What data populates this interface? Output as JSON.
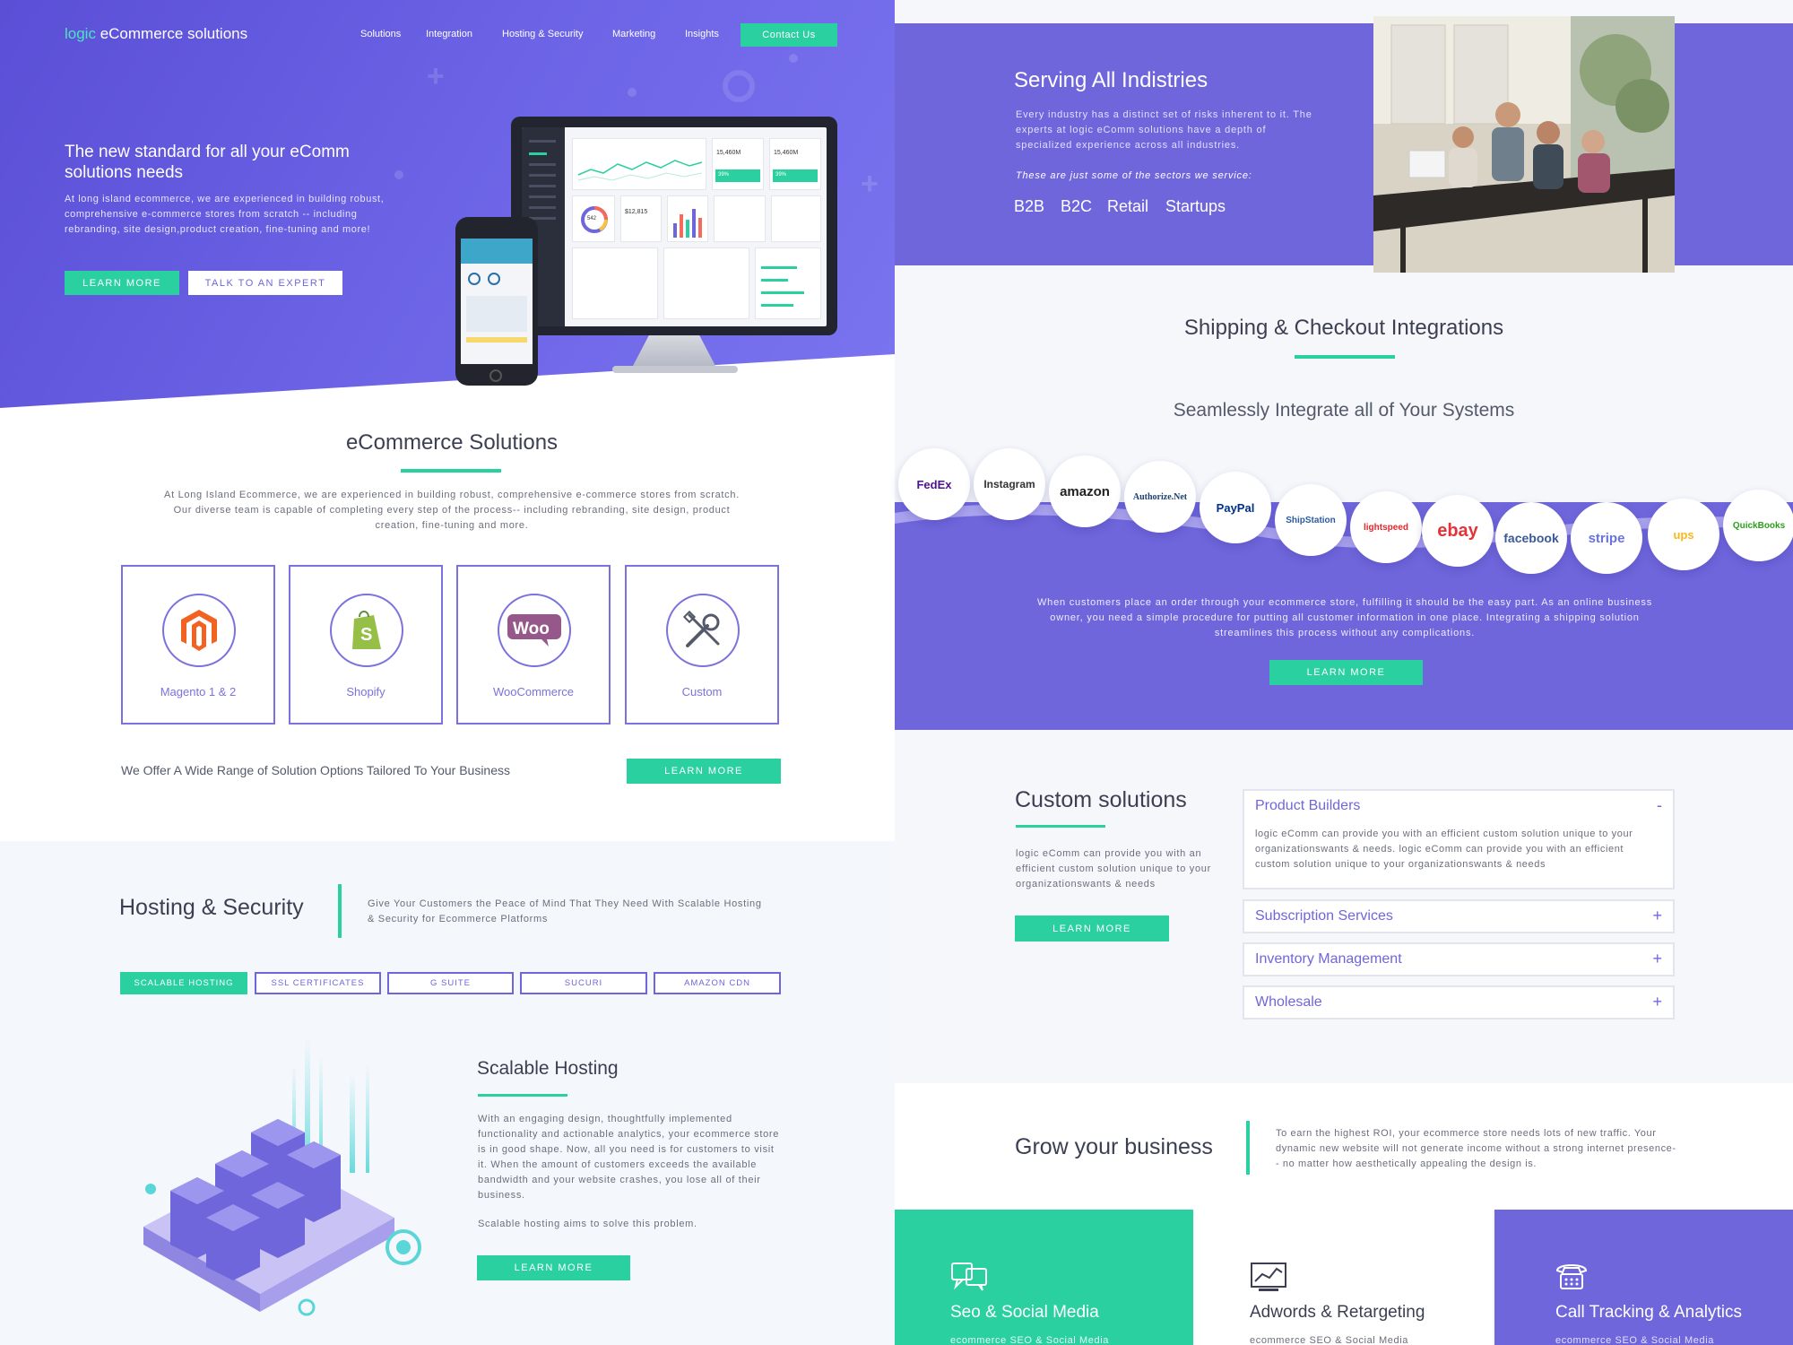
{
  "nav": {
    "logo_prefix": "logic",
    "logo_suffix": "eCommerce solutions",
    "items": [
      "Solutions",
      "Integration",
      "Hosting & Security",
      "Marketing",
      "Insights"
    ],
    "contact": "Contact Us"
  },
  "hero": {
    "title": "The new standard for all your eComm solutions needs",
    "text": "At long island ecommerce, we are experienced in building robust, comprehensive e-commerce stores from scratch -- including rebranding, site design,product creation, fine-tuning and more!",
    "learn_more": "LEARN MORE",
    "talk": "TALK TO AN EXPERT"
  },
  "dashboard": {
    "kpi1": "15,460M",
    "kpi2": "15,460M",
    "pct1": "39%",
    "pct2": "39%",
    "donut": "542",
    "bar_value": "$12,815"
  },
  "solutions": {
    "title": "eCommerce Solutions",
    "text": "At Long Island Ecommerce, we are experienced in building robust, comprehensive e-commerce stores from scratch. Our diverse team is capable of completing every step of the process-- including rebranding, site design, product creation, fine-tuning and more.",
    "items": [
      {
        "label": "Magento 1 & 2",
        "icon": "magento-icon"
      },
      {
        "label": "Shopify",
        "icon": "shopify-icon"
      },
      {
        "label": "WooCommerce",
        "icon": "woocommerce-icon"
      },
      {
        "label": "Custom",
        "icon": "tools-icon"
      }
    ],
    "offer_text": "We Offer A Wide Range of Solution Options Tailored To Your Business",
    "learn_more": "LEARN MORE"
  },
  "hosting": {
    "title": "Hosting & Security",
    "tagline": "Give Your Customers the Peace of Mind That They Need With Scalable Hosting & Security for Ecommerce Platforms",
    "tabs": [
      "SCALABLE HOSTING",
      "SSL CERTIFICATES",
      "G SUITE",
      "SUCURI",
      "AMAZON CDN"
    ],
    "sub_title": "Scalable Hosting",
    "body": "With an engaging design, thoughtfully implemented functionality and actionable analytics, your ecommerce store is in good shape. Now, all you need is for customers to visit it. When the amount of customers exceeds the available bandwidth and your website crashes, you lose all of their business.",
    "body2": "Scalable hosting aims to solve this problem.",
    "learn_more": "LEARN MORE"
  },
  "serving": {
    "title": "Serving All Indistries",
    "text": "Every industry has a distinct set of risks inherent to it. The experts at logic eComm solutions have a depth of specialized experience across all industries.",
    "italic": "These are just some of the sectors we service:",
    "sectors": [
      "B2B",
      "B2C",
      "Retail",
      "Startups"
    ]
  },
  "integrations": {
    "title": "Shipping & Checkout Integrations",
    "subtitle": "Seamlessly Integrate all of Your Systems",
    "logos": [
      "FedEx",
      "Instagram",
      "amazon",
      "Authorize.Net",
      "PayPal",
      "ShipStation",
      "lightspeed",
      "ebay",
      "facebook",
      "stripe",
      "ups",
      "QuickBooks"
    ],
    "text": "When customers place an order through your ecommerce store, fulfilling it should be the easy part. As an online business owner, you need a simple procedure for putting all customer information in one place. Integrating a shipping solution streamlines this process without any complications.",
    "learn_more": "LEARN MORE"
  },
  "custom": {
    "title": "Custom solutions",
    "text": "logic eComm can provide you with an efficient custom solution unique to your organizationswants & needs",
    "learn_more": "LEARN MORE",
    "accordion": [
      {
        "title": "Product Builders",
        "sign": "-",
        "body": "logic eComm can provide you with an efficient custom solution unique to your organizationswants & needs. logic eComm can provide you with an efficient custom solution unique to your organizationswants & needs"
      },
      {
        "title": "Subscription Services",
        "sign": "+"
      },
      {
        "title": "Inventory Management",
        "sign": "+"
      },
      {
        "title": "Wholesale",
        "sign": "+"
      }
    ]
  },
  "grow": {
    "title": "Grow your business",
    "text": "To earn the highest ROI, your ecommerce store needs lots of new traffic. Your dynamic new website will not generate income without a strong internet presence-- no matter how aesthetically appealing the design is.",
    "cards": [
      {
        "title": "Seo & Social Media",
        "sub": "ecommerce SEO & Social Media",
        "icon": "chat-bubbles-icon"
      },
      {
        "title": "Adwords & Retargeting",
        "sub": "ecommerce SEO & Social Media",
        "icon": "analytics-chart-icon"
      },
      {
        "title": "Call Tracking & Analytics",
        "sub": "ecommerce SEO & Social Media",
        "icon": "telephone-icon"
      }
    ]
  },
  "colors": {
    "purple": "#6f66dc",
    "teal": "#2bd0a0",
    "dark": "#3c3f52"
  }
}
